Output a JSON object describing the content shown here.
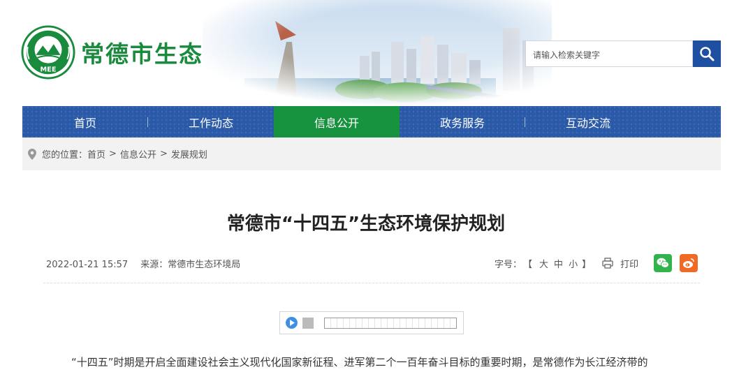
{
  "header": {
    "site_name": "常德市生态环境局",
    "logo_caption": "MEE",
    "search_placeholder": "请输入检索关键字"
  },
  "nav": {
    "items": [
      {
        "label": "首页"
      },
      {
        "label": "工作动态"
      },
      {
        "label": "信息公开"
      },
      {
        "label": "政务服务"
      },
      {
        "label": "互动交流"
      }
    ],
    "active_index": 2
  },
  "breadcrumb": {
    "prefix": "您的位置：",
    "items": [
      "首页",
      "信息公开",
      "发展规划"
    ],
    "separator": ">"
  },
  "article": {
    "title": "常德市“十四五”生态环境保护规划",
    "datetime": "2022-01-21 15:57",
    "source": "来源：常德市生态环境局",
    "font_size_label": "字号：",
    "font_sizes": [
      "大",
      "中",
      "小"
    ],
    "print_label": "打印",
    "first_paragraph": "“十四五”时期是开启全面建设社会主义现代化国家新征程、进军第二个一百年奋斗目标的重要时期，是常德作为长江经济带的"
  },
  "colors": {
    "brand_green": "#1a8a3c",
    "nav_blue": "#2a59a8",
    "nav_active_green": "#17923f",
    "search_blue": "#1f4fa0",
    "wechat_green": "#33b34d",
    "weibo_orange": "#f06a26"
  }
}
